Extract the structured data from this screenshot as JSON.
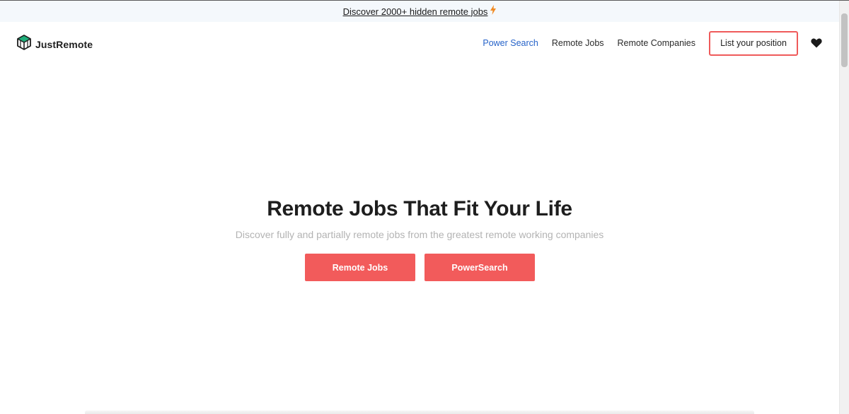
{
  "announcement": {
    "text": "Discover 2000+ hidden remote jobs",
    "icon": "lightning-bolt-icon",
    "icon_color": "#f08a24"
  },
  "header": {
    "logo_text": "JustRemote",
    "logo_icon": "cube-logo-icon",
    "nav": {
      "power_search": "Power Search",
      "remote_jobs": "Remote Jobs",
      "remote_companies": "Remote Companies"
    },
    "list_position_label": "List your position",
    "favorites_icon": "heart-icon"
  },
  "hero": {
    "title": "Remote Jobs That Fit Your Life",
    "subtitle": "Discover fully and partially remote jobs from the greatest remote working companies",
    "buttons": {
      "remote_jobs": "Remote Jobs",
      "power_search": "PowerSearch"
    }
  },
  "colors": {
    "accent": "#f25b5b",
    "active_nav": "#2663c9",
    "logo_green": "#1fae7a",
    "announcement_bg": "#f4f8fc"
  }
}
